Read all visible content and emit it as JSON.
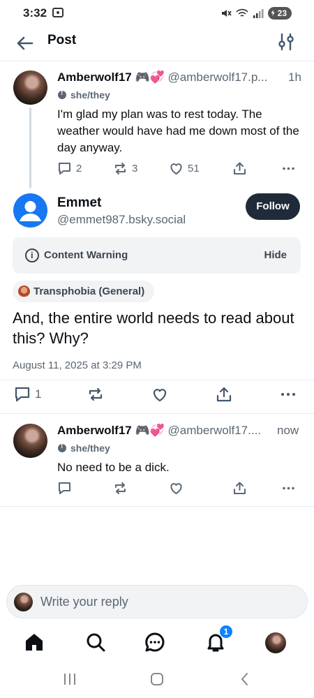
{
  "status_bar": {
    "time": "3:32",
    "battery": "23"
  },
  "header": {
    "title": "Post"
  },
  "parent_post": {
    "display_name": "Amberwolf17 🎮💞",
    "handle": "@amberwolf17.p...",
    "time": "1h",
    "pronouns": "she/they",
    "text": "I'm glad my plan was to rest today. The weather would have had me down most of the day anyway.",
    "replies": "2",
    "reposts": "3",
    "likes": "51"
  },
  "focus_post": {
    "display_name": "Emmet",
    "handle": "@emmet987.bsky.social",
    "follow_label": "Follow",
    "content_warning_label": "Content Warning",
    "hide_label": "Hide",
    "moderation_label": "Transphobia (General)",
    "text": "And, the entire world needs to read about this?  Why?",
    "timestamp": "August 11, 2025 at 3:29 PM",
    "replies": "1"
  },
  "reply_post": {
    "display_name": "Amberwolf17 🎮💞",
    "handle": "@amberwolf17....",
    "time": "now",
    "pronouns": "she/they",
    "text": "No need to be a dick."
  },
  "composer": {
    "placeholder": "Write your reply"
  },
  "bottom_nav": {
    "notification_count": "1"
  },
  "colors": {
    "accent": "#1083fe",
    "follow_button": "#1f2b38",
    "muted_text": "#5b6773",
    "default_avatar": "#1877f2"
  },
  "icons": [
    "back-arrow-icon",
    "filter-sliders-icon",
    "comment-icon",
    "repost-icon",
    "heart-icon",
    "share-icon",
    "more-icon",
    "info-icon",
    "home-icon",
    "search-icon",
    "chat-icon",
    "bell-icon"
  ]
}
